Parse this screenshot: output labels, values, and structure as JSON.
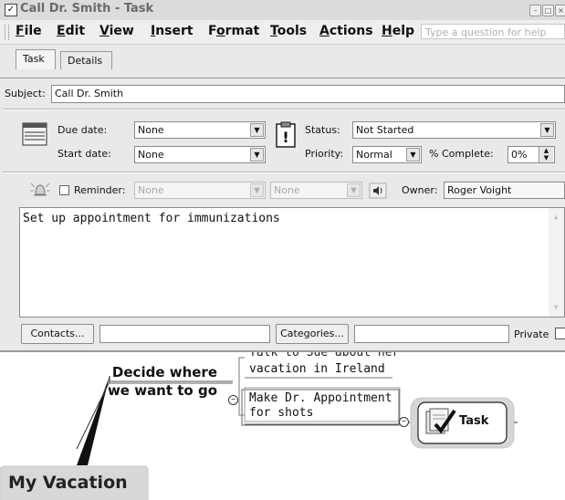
{
  "window": {
    "title": "Call Dr. Smith - Task"
  },
  "menu": {
    "items": [
      {
        "pre": "",
        "u": "F",
        "post": "ile"
      },
      {
        "pre": "",
        "u": "E",
        "post": "dit"
      },
      {
        "pre": "",
        "u": "V",
        "post": "iew"
      },
      {
        "pre": "",
        "u": "I",
        "post": "nsert"
      },
      {
        "pre": "F",
        "u": "o",
        "post": "rmat"
      },
      {
        "pre": "",
        "u": "T",
        "post": "ools"
      },
      {
        "pre": "",
        "u": "A",
        "post": "ctions"
      },
      {
        "pre": "",
        "u": "H",
        "post": "elp"
      }
    ],
    "help_placeholder": "Type a question for help"
  },
  "tabs": [
    "Task",
    "Details"
  ],
  "subject": {
    "label": "Subject:",
    "value": "Call Dr. Smith"
  },
  "dates": {
    "due_label": "Due date:",
    "due_value": "None",
    "start_label": "Start date:",
    "start_value": "None"
  },
  "status": {
    "status_label": "Status:",
    "status_value": "Not Started",
    "priority_label": "Priority:",
    "priority_value": "Normal",
    "complete_label": "% Complete:",
    "complete_value": "0%"
  },
  "reminder": {
    "label": "Reminder:",
    "date_value": "None",
    "time_value": "None",
    "owner_label": "Owner:",
    "owner_value": "Roger Voight"
  },
  "notes": "Set up appointment for immunizations",
  "footer": {
    "contacts_label": "Contacts...",
    "categories_label": "Categories...",
    "private_label": "Private"
  },
  "mindmap": {
    "partial_topic": "Talk to Sue about her",
    "vacation_topic": "vacation in Ireland",
    "decide_line1": "Decide where",
    "decide_line2": "we want to go",
    "appointment_line1": "Make Dr. Appointment",
    "appointment_line2": "for shots",
    "task_label": "Task",
    "root_label": "My Vacation"
  }
}
